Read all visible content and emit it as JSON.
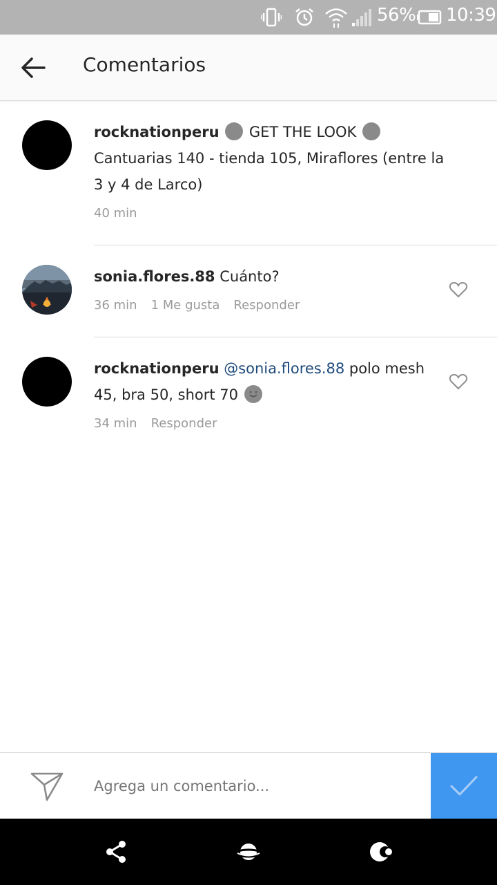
{
  "status_bar": {
    "battery": "56%",
    "time": "10:39",
    "icons": [
      "vibrate-icon",
      "alarm-icon",
      "wifi-icon",
      "signal-icon",
      "battery-icon"
    ]
  },
  "header": {
    "title": "Comentarios",
    "back_icon": "back-arrow-icon"
  },
  "comments": [
    {
      "username": "rocknationperu",
      "text_part1": "GET THE LOOK",
      "text_part2": "Cantuarias 140 - tienda 105, Miraflores (entre la 3 y 4 de Larco)",
      "time": "40 min"
    },
    {
      "username": "sonia.flores.88",
      "text": "Cuánto?",
      "time": "36 min",
      "likes": "1 Me gusta",
      "reply": "Responder"
    },
    {
      "username": "rocknationperu",
      "mention": "@sonia.flores.88",
      "text": "polo mesh 45, bra 50, short 70",
      "time": "34 min",
      "reply": "Responder"
    }
  ],
  "composer": {
    "placeholder": "Agrega un comentario..."
  },
  "colors": {
    "accent": "#3f97f0",
    "mention": "#1e4a7a",
    "status_bar": "#b3b3b3"
  }
}
